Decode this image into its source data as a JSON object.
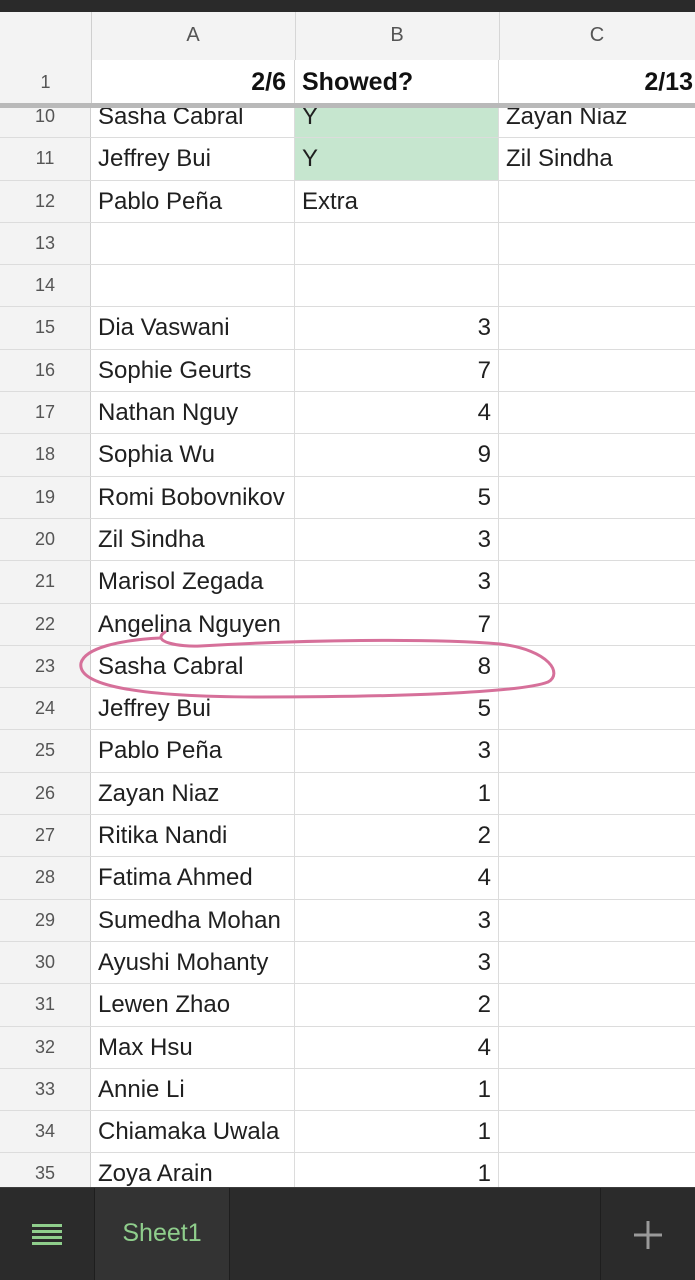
{
  "sheet": {
    "columns": [
      "A",
      "B",
      "C"
    ],
    "frozen_row": {
      "number": "1",
      "cells": [
        "2/6",
        "Showed?",
        "2/13"
      ]
    },
    "rows": [
      {
        "number": "10",
        "a": "Sasha Cabral",
        "b": "Y",
        "c": "Zayan Niaz"
      },
      {
        "number": "11",
        "a": "Jeffrey Bui",
        "b": "Y",
        "c": "Zil Sindha"
      },
      {
        "number": "12",
        "a": "Pablo Peña",
        "b": "Extra",
        "c": ""
      },
      {
        "number": "13",
        "a": "",
        "b": "",
        "c": ""
      },
      {
        "number": "14",
        "a": "",
        "b": "",
        "c": ""
      },
      {
        "number": "15",
        "a": "Dia Vaswani",
        "b": "3",
        "c": ""
      },
      {
        "number": "16",
        "a": "Sophie Geurts",
        "b": "7",
        "c": ""
      },
      {
        "number": "17",
        "a": "Nathan Nguy",
        "b": "4",
        "c": ""
      },
      {
        "number": "18",
        "a": "Sophia Wu",
        "b": "9",
        "c": ""
      },
      {
        "number": "19",
        "a": "Romi Bobovnikov",
        "b": "5",
        "c": ""
      },
      {
        "number": "20",
        "a": "Zil Sindha",
        "b": "3",
        "c": ""
      },
      {
        "number": "21",
        "a": "Marisol Zegada",
        "b": "3",
        "c": ""
      },
      {
        "number": "22",
        "a": "Angelina Nguyen",
        "b": "7",
        "c": ""
      },
      {
        "number": "23",
        "a": "Sasha Cabral",
        "b": "8",
        "c": ""
      },
      {
        "number": "24",
        "a": "Jeffrey Bui",
        "b": "5",
        "c": ""
      },
      {
        "number": "25",
        "a": "Pablo Peña",
        "b": "3",
        "c": ""
      },
      {
        "number": "26",
        "a": "Zayan Niaz",
        "b": "1",
        "c": ""
      },
      {
        "number": "27",
        "a": "Ritika Nandi",
        "b": "2",
        "c": ""
      },
      {
        "number": "28",
        "a": "Fatima Ahmed",
        "b": "4",
        "c": ""
      },
      {
        "number": "29",
        "a": "Sumedha Mohan",
        "b": "3",
        "c": ""
      },
      {
        "number": "30",
        "a": "Ayushi Mohanty",
        "b": "3",
        "c": ""
      },
      {
        "number": "31",
        "a": "Lewen Zhao",
        "b": "2",
        "c": ""
      },
      {
        "number": "32",
        "a": "Max Hsu",
        "b": "4",
        "c": ""
      },
      {
        "number": "33",
        "a": "Annie Li",
        "b": "1",
        "c": ""
      },
      {
        "number": "34",
        "a": "Chiamaka Uwala",
        "b": "1",
        "c": ""
      },
      {
        "number": "35",
        "a": "Zoya Arain",
        "b": "1",
        "c": ""
      }
    ]
  },
  "bottom_bar": {
    "menu_icon": "hamburger-menu-icon",
    "sheet_tab_label": "Sheet1",
    "add_icon": "plus-icon",
    "tab_color": "#8fce8c"
  },
  "highlight": {
    "green_cell_color": "#c6e6cf",
    "annotation_color": "#d6709a"
  }
}
